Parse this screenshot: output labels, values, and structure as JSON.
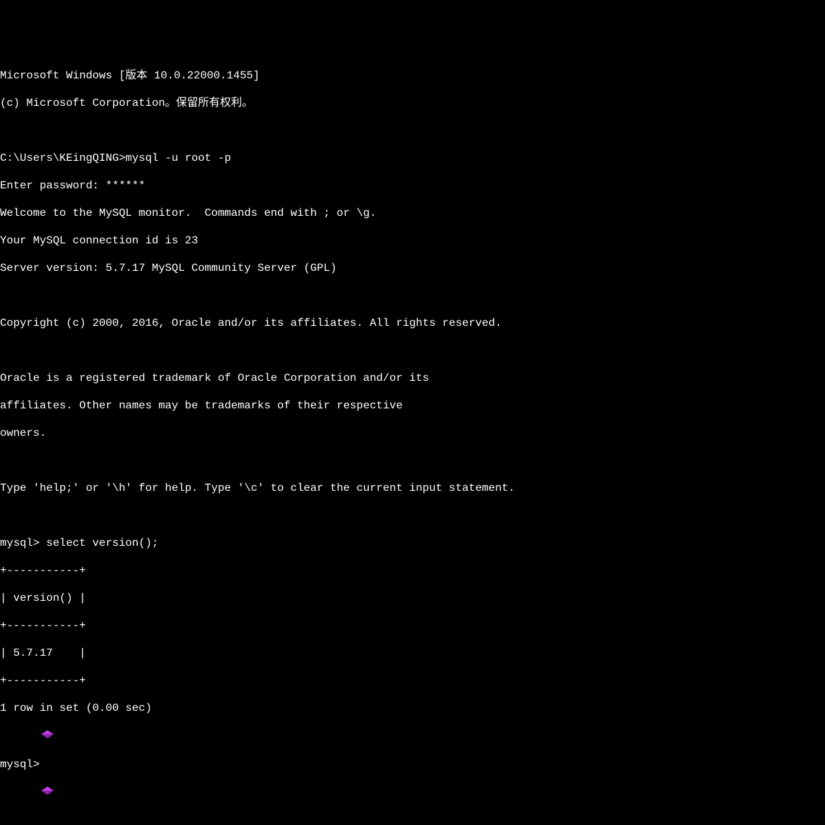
{
  "terminal": {
    "lines": {
      "l1": "Microsoft Windows [版本 10.0.22000.1455]",
      "l2": "(c) Microsoft Corporation。保留所有权利。",
      "l3": "",
      "l4": "C:\\Users\\KEingQING>mysql -u root -p",
      "l5": "Enter password: ******",
      "l6": "Welcome to the MySQL monitor.  Commands end with ; or \\g.",
      "l7": "Your MySQL connection id is 23",
      "l8": "Server version: 5.7.17 MySQL Community Server (GPL)",
      "l9": "",
      "l10": "Copyright (c) 2000, 2016, Oracle and/or its affiliates. All rights reserved.",
      "l11": "",
      "l12": "Oracle is a registered trademark of Oracle Corporation and/or its",
      "l13": "affiliates. Other names may be trademarks of their respective",
      "l14": "owners.",
      "l15": "",
      "l16": "Type 'help;' or '\\h' for help. Type '\\c' to clear the current input statement.",
      "l17": "",
      "l18": "mysql> select version();",
      "l19": "+-----------+",
      "l20": "| version() |",
      "l21": "+-----------+",
      "l22": "| 5.7.17    |",
      "l23": "+-----------+",
      "l24": "1 row in set (0.00 sec)",
      "l25": "",
      "l26": "mysql>"
    }
  }
}
